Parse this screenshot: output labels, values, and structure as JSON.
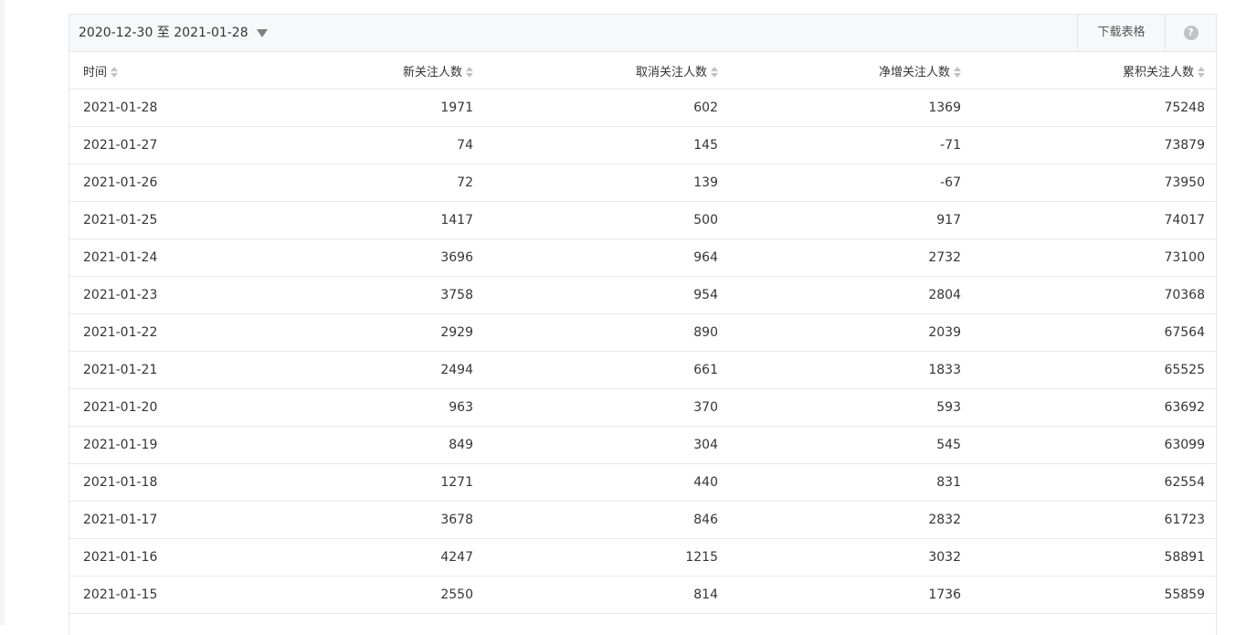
{
  "toolbar": {
    "date_range": "2020-12-30 至 2021-01-28",
    "download_label": "下载表格",
    "help_label": "?"
  },
  "table": {
    "headers": [
      "时间",
      "新关注人数",
      "取消关注人数",
      "净增关注人数",
      "累积关注人数"
    ],
    "rows": [
      [
        "2021-01-28",
        "1971",
        "602",
        "1369",
        "75248"
      ],
      [
        "2021-01-27",
        "74",
        "145",
        "-71",
        "73879"
      ],
      [
        "2021-01-26",
        "72",
        "139",
        "-67",
        "73950"
      ],
      [
        "2021-01-25",
        "1417",
        "500",
        "917",
        "74017"
      ],
      [
        "2021-01-24",
        "3696",
        "964",
        "2732",
        "73100"
      ],
      [
        "2021-01-23",
        "3758",
        "954",
        "2804",
        "70368"
      ],
      [
        "2021-01-22",
        "2929",
        "890",
        "2039",
        "67564"
      ],
      [
        "2021-01-21",
        "2494",
        "661",
        "1833",
        "65525"
      ],
      [
        "2021-01-20",
        "963",
        "370",
        "593",
        "63692"
      ],
      [
        "2021-01-19",
        "849",
        "304",
        "545",
        "63099"
      ],
      [
        "2021-01-18",
        "1271",
        "440",
        "831",
        "62554"
      ],
      [
        "2021-01-17",
        "3678",
        "846",
        "2832",
        "61723"
      ],
      [
        "2021-01-16",
        "4247",
        "1215",
        "3032",
        "58891"
      ],
      [
        "2021-01-15",
        "2550",
        "814",
        "1736",
        "55859"
      ]
    ]
  }
}
